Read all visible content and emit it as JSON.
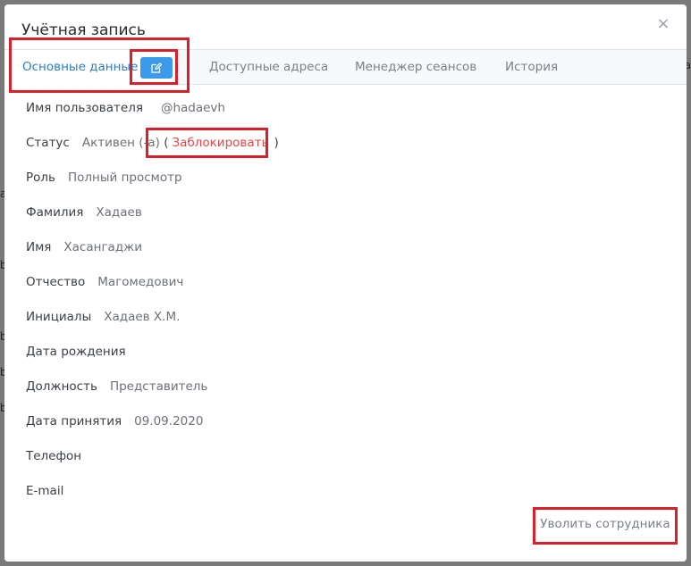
{
  "modal": {
    "title": "Учётная запись",
    "close_glyph": "×"
  },
  "tabs": [
    {
      "label": "Основные данные",
      "active": true
    },
    {
      "label": "Доступные адреса",
      "active": false
    },
    {
      "label": "Менеджер сеансов",
      "active": false
    },
    {
      "label": "История",
      "active": false
    }
  ],
  "fields": {
    "username": {
      "label": "Имя пользователя",
      "value": "@hadaevh"
    },
    "status": {
      "label": "Статус",
      "value": "Активен (-а)",
      "open_paren": "(",
      "action": "Заблокировать",
      "close_paren": ")"
    },
    "role": {
      "label": "Роль",
      "value": "Полный просмотр"
    },
    "last_name": {
      "label": "Фамилия",
      "value": "Хадаев"
    },
    "first_name": {
      "label": "Имя",
      "value": "Хасангаджи"
    },
    "patronymic": {
      "label": "Отчество",
      "value": "Магомедович"
    },
    "initials": {
      "label": "Инициалы",
      "value": "Хадаев Х.М."
    },
    "birth_date": {
      "label": "Дата рождения",
      "value": ""
    },
    "position": {
      "label": "Должность",
      "value": "Представитель"
    },
    "hire_date": {
      "label": "Дата принятия",
      "value": "09.09.2020"
    },
    "phone": {
      "label": "Телефон",
      "value": ""
    },
    "email": {
      "label": "E-mail",
      "value": ""
    }
  },
  "footer": {
    "fire_button": "Уволить сотрудника"
  },
  "background_glyphs": {
    "right_top": "a",
    "left": [
      "a",
      "b",
      "b",
      "b",
      "b"
    ]
  },
  "colors": {
    "accent": "#3b9bea",
    "active_tab": "#2d7fc1",
    "danger_link": "#e04848",
    "highlight": "#d8202b"
  },
  "icons": {
    "edit": "edit-icon",
    "close": "close-icon"
  }
}
